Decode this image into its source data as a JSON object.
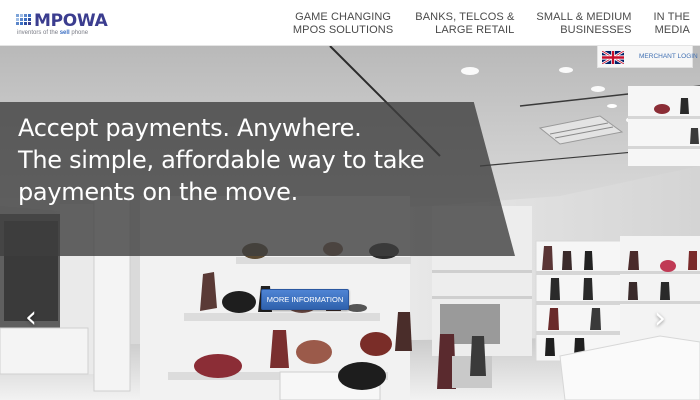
{
  "header": {
    "logo": {
      "wordmark": "MPOWA",
      "tagline_prefix": "inventors of the ",
      "tagline_highlight": "sell",
      "tagline_suffix": " phone"
    },
    "nav": [
      {
        "label": "GAME CHANGING\nMPOS SOLUTIONS"
      },
      {
        "label": "BANKS, TELCOS &\nLARGE RETAIL"
      },
      {
        "label": "SMALL & MEDIUM\nBUSINESSES"
      },
      {
        "label": "IN THE\nMEDIA"
      }
    ],
    "merchant_login": "MERCHANT LOGIN",
    "flag_icon": "uk-flag-icon"
  },
  "hero": {
    "headline": [
      "Accept payments. Anywhere.",
      "The simple, affordable way to take",
      "payments on the move."
    ],
    "button": "MORE INFORMATION",
    "prev_icon": "chevron-left-icon",
    "next_icon": "chevron-right-icon"
  },
  "colors": {
    "brand": "#3b3d8f",
    "button": "#3a6fc0",
    "link": "#3f6fb2",
    "panel": "#3e3e3e"
  }
}
